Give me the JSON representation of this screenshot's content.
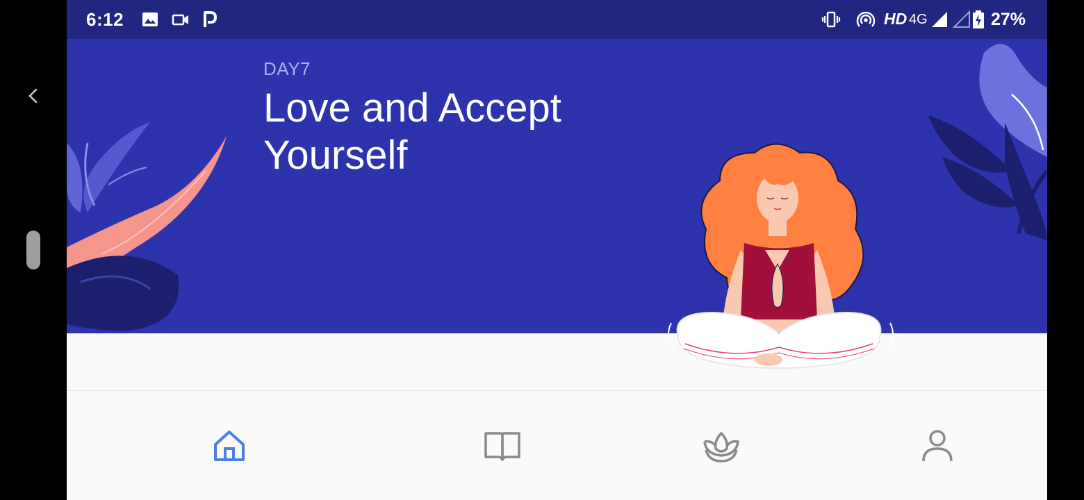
{
  "status_bar": {
    "time": "6:12",
    "network_label": "HD",
    "network_type": "4G",
    "battery": "27%",
    "icons": [
      "image-icon",
      "video-camera-icon",
      "p-app-icon",
      "vibrate-icon",
      "hotspot-icon",
      "signal-icon",
      "signal-empty-icon",
      "battery-charging-icon"
    ]
  },
  "hero": {
    "day_label": "DAY7",
    "title": "Love and Accept Yourself"
  },
  "bottom_nav": {
    "items": [
      {
        "name": "home",
        "icon": "home-icon",
        "active": true
      },
      {
        "name": "library",
        "icon": "book-icon",
        "active": false
      },
      {
        "name": "meditate",
        "icon": "lotus-icon",
        "active": false
      },
      {
        "name": "profile",
        "icon": "user-icon",
        "active": false
      }
    ]
  },
  "colors": {
    "status_bar": "#212680",
    "hero_bg": "#2d32ad",
    "active_nav": "#4a7fe6",
    "inactive_nav": "#8a8a8a"
  }
}
